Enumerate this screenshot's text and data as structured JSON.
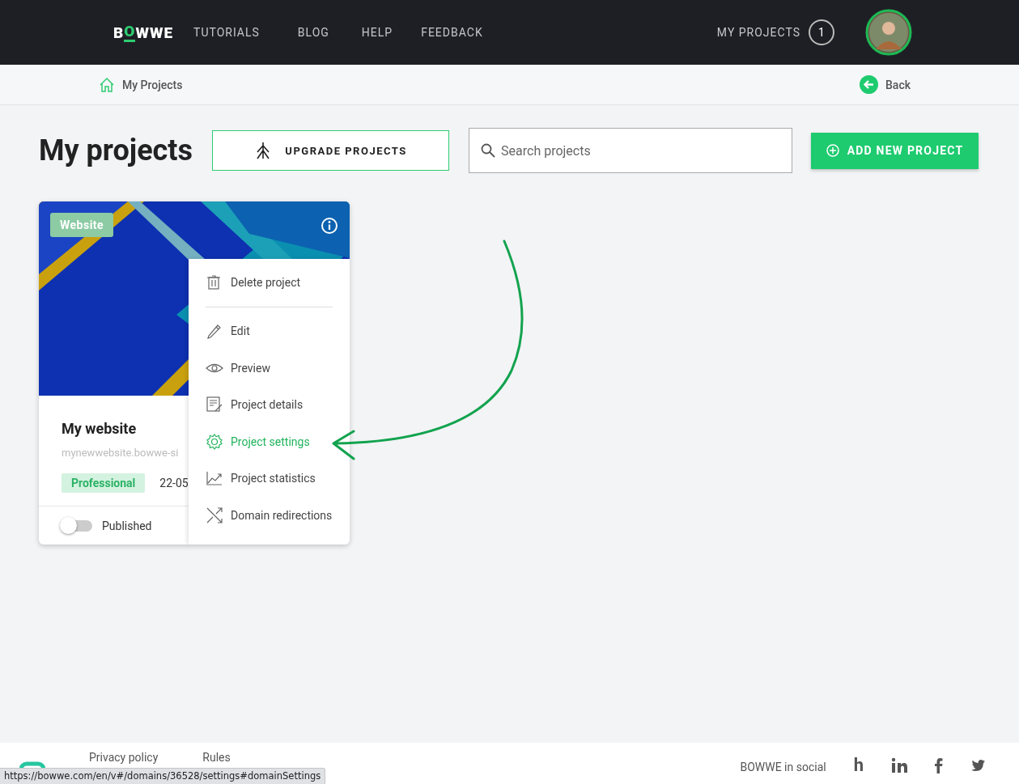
{
  "header": {
    "logo": "BOWWE",
    "nav": [
      {
        "label": "TUTORIALS"
      },
      {
        "label": "BLOG"
      },
      {
        "label": "HELP"
      },
      {
        "label": "FEEDBACK"
      }
    ],
    "my_projects": {
      "label": "MY PROJECTS",
      "count": "1"
    }
  },
  "breadcrumb": {
    "label": "My Projects",
    "back": "Back"
  },
  "page": {
    "title": "My projects",
    "upgrade_button": "UPGRADE PROJECTS",
    "search": {
      "placeholder": "Search projects"
    },
    "add_button": "ADD NEW PROJECT"
  },
  "project": {
    "badge": "Website",
    "name": "My website",
    "domain": "mynewwebsite.bowwe-si",
    "plan": "Professional",
    "date": "22-05",
    "published": {
      "label": "Published",
      "on": false
    },
    "menu": {
      "groups": [
        [
          {
            "label": "Delete project",
            "selected": false
          }
        ],
        [
          {
            "label": "Edit",
            "selected": false
          },
          {
            "label": "Preview",
            "selected": false
          },
          {
            "label": "Project details",
            "selected": false
          },
          {
            "label": "Project settings",
            "selected": true
          },
          {
            "label": "Project statistics",
            "selected": false
          },
          {
            "label": "Domain redirections",
            "selected": false
          }
        ]
      ]
    }
  },
  "footer": {
    "links": [
      "Privacy policy",
      "Rules"
    ],
    "social_label": "BOWWE in social",
    "social": [
      {
        "label": "h"
      }
    ]
  },
  "status_url": "https://bowwe.com/en/v#/domains/36528/settings#domainSettings"
}
